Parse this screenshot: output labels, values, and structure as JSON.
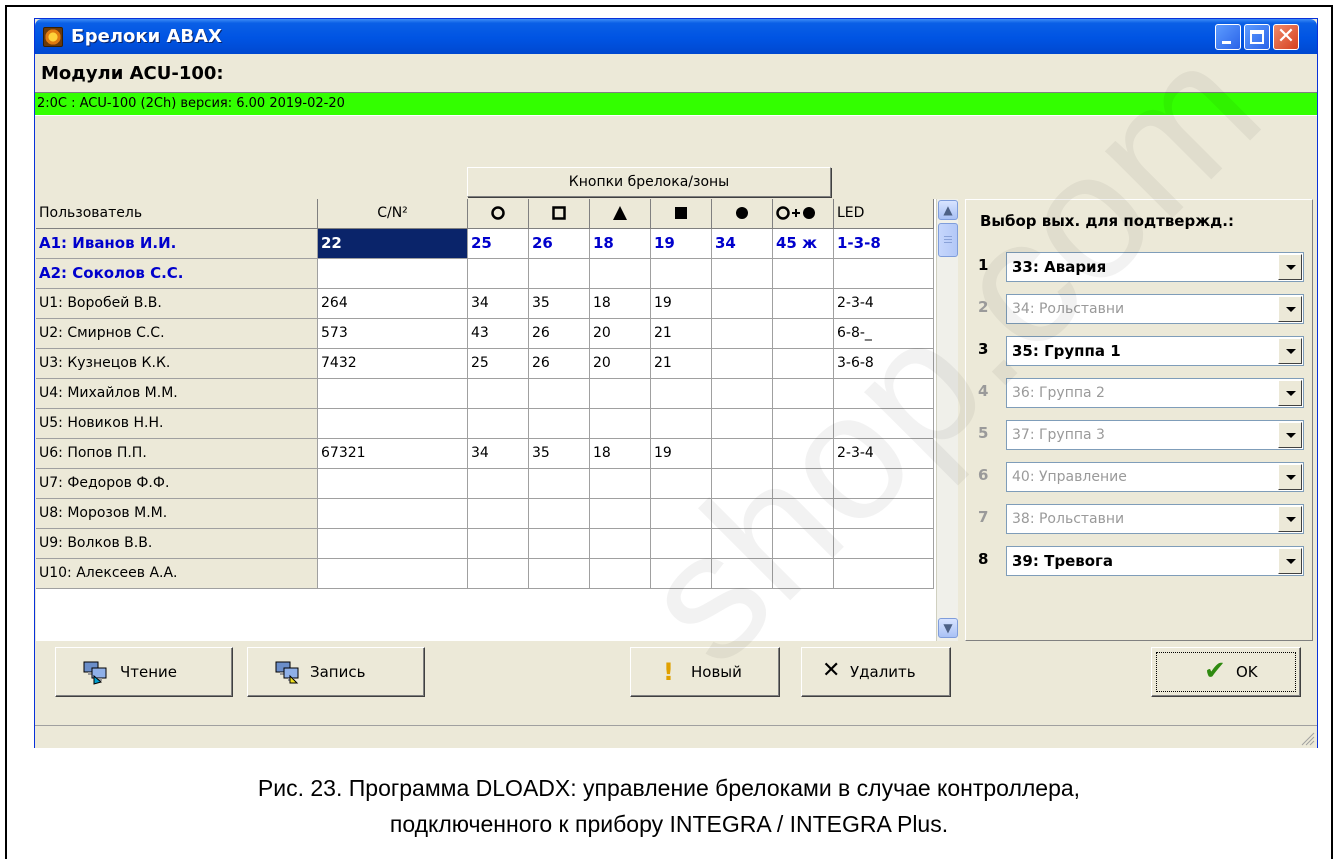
{
  "window": {
    "title": "Брелоки ABAX",
    "modules_label": "Модули ACU-100:",
    "module_line": "2:0C :  ACU-100   (2Ch) версия: 6.00 2019-02-20"
  },
  "table": {
    "group_header": "Кнопки брелока/зоны",
    "columns": [
      "Пользователь",
      "C/N²",
      "○",
      "□",
      "▲",
      "■",
      "●",
      "O+●",
      "LED"
    ],
    "rows": [
      {
        "user": "A1: Иванов И.И.",
        "cn": "22",
        "b1": "25",
        "b2": "26",
        "b3": "18",
        "b4": "19",
        "b5": "34",
        "b6": "45 ж",
        "led": "1-3-8"
      },
      {
        "user": "A2: Соколов С.С.",
        "cn": "",
        "b1": "",
        "b2": "",
        "b3": "",
        "b4": "",
        "b5": "",
        "b6": "",
        "led": ""
      },
      {
        "user": "U1: Воробей В.В.",
        "cn": "264",
        "b1": "34",
        "b2": "35",
        "b3": "18",
        "b4": "19",
        "b5": "",
        "b6": "",
        "led": "2-3-4"
      },
      {
        "user": "U2: Смирнов С.С.",
        "cn": "573",
        "b1": "43",
        "b2": "26",
        "b3": "20",
        "b4": "21",
        "b5": "",
        "b6": "",
        "led": "6-8-_"
      },
      {
        "user": "U3: Кузнецов К.К.",
        "cn": "7432",
        "b1": "25",
        "b2": "26",
        "b3": "20",
        "b4": "21",
        "b5": "",
        "b6": "",
        "led": "3-6-8"
      },
      {
        "user": "U4: Михайлов М.М.",
        "cn": "",
        "b1": "",
        "b2": "",
        "b3": "",
        "b4": "",
        "b5": "",
        "b6": "",
        "led": ""
      },
      {
        "user": "U5: Новиков Н.Н.",
        "cn": "",
        "b1": "",
        "b2": "",
        "b3": "",
        "b4": "",
        "b5": "",
        "b6": "",
        "led": ""
      },
      {
        "user": "U6: Попов П.П.",
        "cn": "67321",
        "b1": "34",
        "b2": "35",
        "b3": "18",
        "b4": "19",
        "b5": "",
        "b6": "",
        "led": "2-3-4"
      },
      {
        "user": "U7: Федоров Ф.Ф.",
        "cn": "",
        "b1": "",
        "b2": "",
        "b3": "",
        "b4": "",
        "b5": "",
        "b6": "",
        "led": ""
      },
      {
        "user": "U8: Морозов М.М.",
        "cn": "",
        "b1": "",
        "b2": "",
        "b3": "",
        "b4": "",
        "b5": "",
        "b6": "",
        "led": ""
      },
      {
        "user": "U9: Волков В.В.",
        "cn": "",
        "b1": "",
        "b2": "",
        "b3": "",
        "b4": "",
        "b5": "",
        "b6": "",
        "led": ""
      },
      {
        "user": "U10: Алексеев А.А.",
        "cn": "",
        "b1": "",
        "b2": "",
        "b3": "",
        "b4": "",
        "b5": "",
        "b6": "",
        "led": ""
      }
    ]
  },
  "confirm": {
    "title": "Выбор вых. для подтвержд.:",
    "outputs": [
      {
        "num": "1",
        "value": "33: Авария",
        "enabled": true
      },
      {
        "num": "2",
        "value": "34: Рольставни",
        "enabled": false
      },
      {
        "num": "3",
        "value": "35: Группа 1",
        "enabled": true
      },
      {
        "num": "4",
        "value": "36: Группа 2",
        "enabled": false
      },
      {
        "num": "5",
        "value": "37: Группа 3",
        "enabled": false
      },
      {
        "num": "6",
        "value": "40: Управление",
        "enabled": false
      },
      {
        "num": "7",
        "value": "38: Рольставни",
        "enabled": false
      },
      {
        "num": "8",
        "value": "39: Тревога",
        "enabled": true
      }
    ]
  },
  "buttons": {
    "read": "Чтение",
    "write": "Запись",
    "new": "Новый",
    "delete": "Удалить",
    "ok": "OK"
  },
  "caption": {
    "line1": "Рис. 23. Программа DLOADX: управление брелоками в случае контроллера,",
    "line2": "подключенного к прибору INTEGRA / INTEGRA Plus."
  },
  "watermark": "shop.com",
  "colors": {
    "module_bar": "#33ff00",
    "admin_text": "#0000cc",
    "selected_cell": "#0a246a"
  }
}
